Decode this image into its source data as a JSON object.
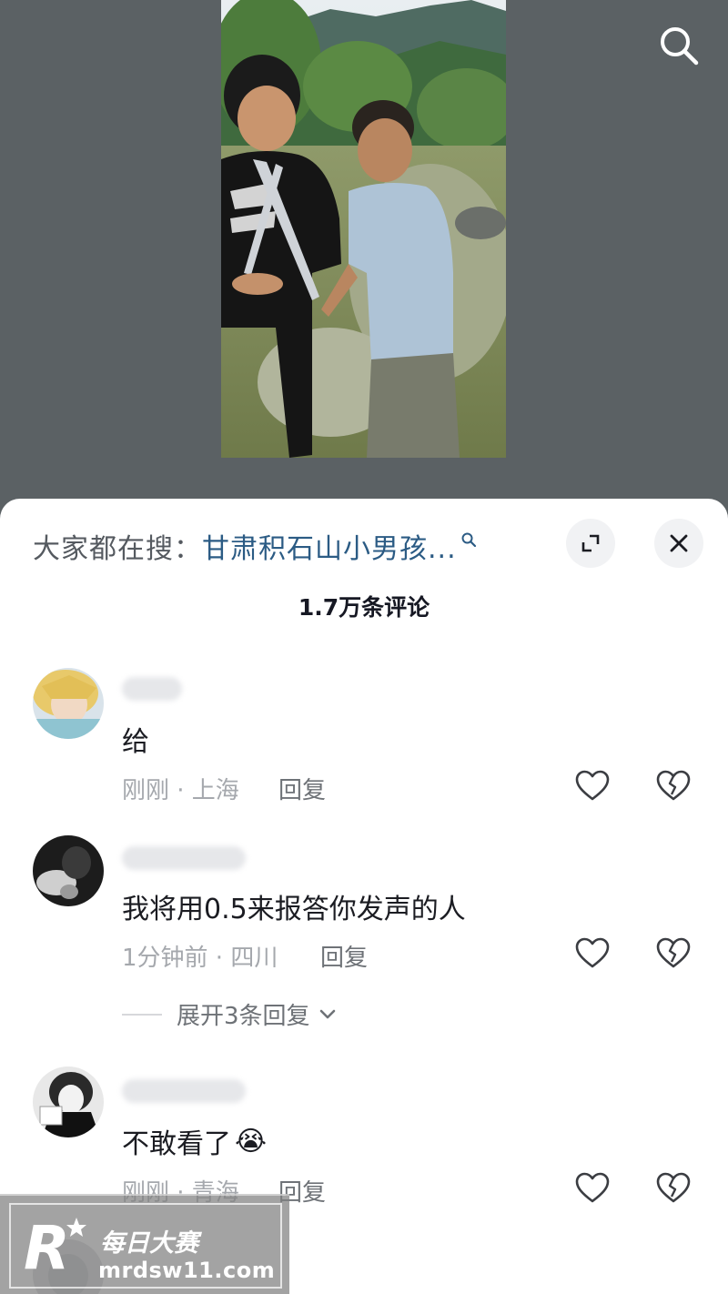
{
  "video": {
    "search_icon": "search-icon"
  },
  "panel": {
    "search_suggest_prefix": "大家都在搜：",
    "search_suggest_query": "甘肃积石山小男孩...",
    "comment_count": "1.7万条评论",
    "icons": {
      "expand": "expand-icon",
      "close": "close-icon"
    }
  },
  "comments": [
    {
      "text": "给",
      "time": "刚刚 · 上海",
      "reply_label": "回复",
      "avatar": "avatar-anime-blond"
    },
    {
      "text": "我将用0.5来报答你发声的人",
      "time": "1分钟前 · 四川",
      "reply_label": "回复",
      "expand_label": "展开3条回复",
      "avatar": "avatar-dark-figure"
    },
    {
      "text": "不敢看了",
      "emoji": "😭",
      "time": "刚刚 · 青海",
      "reply_label": "回复",
      "avatar": "avatar-person-bw"
    }
  ],
  "watermark": {
    "logo_letter": "R",
    "cn": "每日大赛",
    "url": "mrdsw11.com"
  },
  "colors": {
    "background_top": "#5b6164",
    "sheet": "#ffffff",
    "link": "#2b5b84",
    "meta": "#a5a8ad"
  }
}
